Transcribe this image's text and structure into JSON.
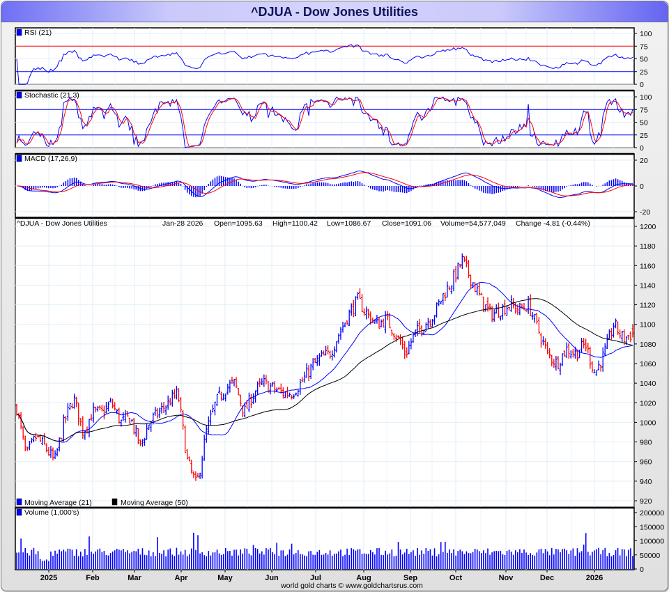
{
  "title": "^DJUA - Dow Jones Utilities",
  "footer": "world gold charts © www.goldchartsrus.com",
  "colors": {
    "up": "#0000ff",
    "down": "#ff0000",
    "ma21": "#0000ff",
    "ma50": "#000000",
    "grid": "#e0eef8",
    "rsi_hi": "#ff0000",
    "rsi_lo": "#0000ff"
  },
  "chart_data": [
    {
      "type": "line",
      "title": "RSI (21)",
      "yticks": [
        "100",
        "75",
        "50",
        "25",
        "0"
      ],
      "ylim": [
        0,
        100
      ],
      "levels": [
        75,
        25
      ]
    },
    {
      "type": "line",
      "title": "Stochastic (21,3)",
      "yticks": [
        "100",
        "75",
        "50",
        "25",
        "0"
      ],
      "ylim": [
        0,
        100
      ],
      "levels": [
        75,
        25
      ]
    },
    {
      "type": "line",
      "title": "MACD (17,26,9)",
      "yticks": [
        "20",
        "0",
        "-20"
      ],
      "ylim": [
        -20,
        20
      ]
    },
    {
      "type": "line",
      "title": "^DJUA - Dow Jones Utilities",
      "quote": {
        "date": "Jan-28  2026",
        "open": "Open=1095.63",
        "high": "High=1100.42",
        "low": "Low=1086.67",
        "close": "Close=1091.06",
        "volume": "Volume=54,577,049",
        "change": "Change -4.81 (-0.44%)"
      },
      "legend": [
        "Moving Average (21)",
        "Moving Average (50)"
      ],
      "yticks": [
        "1200",
        "1180",
        "1160",
        "1140",
        "1120",
        "1100",
        "1080",
        "1060",
        "1040",
        "1020",
        "1000",
        "980",
        "960",
        "940",
        "920"
      ],
      "ylim": [
        920,
        1200
      ],
      "approx_closes_weekly": [
        1015,
        965,
        985,
        975,
        960,
        1000,
        1025,
        990,
        1010,
        1010,
        1020,
        1000,
        1005,
        975,
        1000,
        1010,
        1020,
        1030,
        960,
        935,
        990,
        1020,
        1035,
        1040,
        1010,
        1030,
        1040,
        1035,
        1030,
        1030,
        1040,
        1055,
        1065,
        1070,
        1090,
        1110,
        1125,
        1110,
        1100,
        1105,
        1090,
        1070,
        1090,
        1100,
        1110,
        1130,
        1145,
        1165,
        1145,
        1125,
        1110,
        1115,
        1120,
        1115,
        1120,
        1095,
        1070,
        1060,
        1075,
        1070,
        1080,
        1050,
        1070,
        1100,
        1085,
        1091
      ]
    },
    {
      "type": "bar",
      "title": "Volume (1,000's)",
      "yticks": [
        "200000",
        "150000",
        "100000",
        "50000",
        "0"
      ],
      "ylim": [
        0,
        200000
      ],
      "typical_volume": 60000
    }
  ],
  "xaxis": {
    "months": [
      "2025",
      "Feb",
      "Mar",
      "Apr",
      "May",
      "Jun",
      "Jul",
      "Aug",
      "Sep",
      "Oct",
      "Nov",
      "Dec",
      "2026"
    ]
  }
}
